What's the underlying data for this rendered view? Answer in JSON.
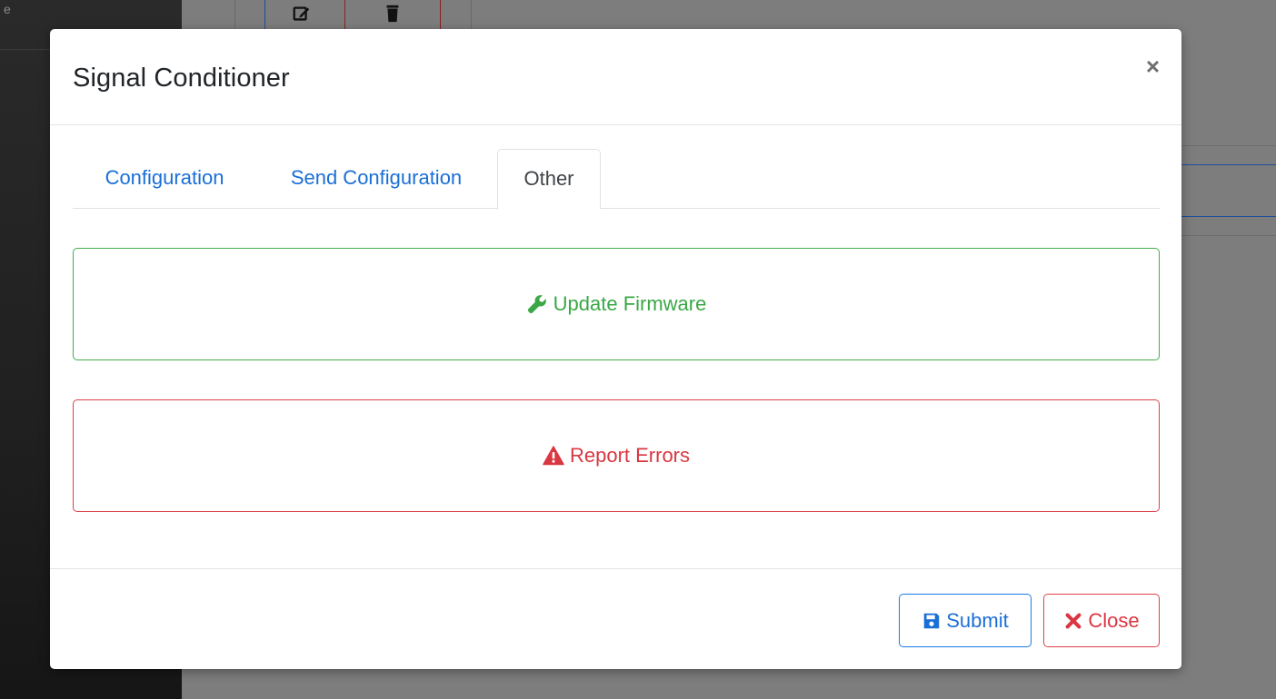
{
  "background": {
    "edge_char": "e"
  },
  "modal": {
    "title": "Signal Conditioner",
    "close_symbol": "×",
    "tabs": [
      {
        "label": "Configuration",
        "active": false
      },
      {
        "label": "Send Configuration",
        "active": false
      },
      {
        "label": "Other",
        "active": true
      }
    ],
    "actions": {
      "update_firmware": {
        "label": "Update Firmware",
        "icon": "wrench-icon",
        "color": "#3aa846"
      },
      "report_errors": {
        "label": "Report Errors",
        "icon": "warning-triangle-icon",
        "color": "#d93741"
      }
    },
    "footer": {
      "submit_label": "Submit",
      "submit_icon": "save-icon",
      "close_label": "Close",
      "close_icon": "x-icon"
    }
  },
  "colors": {
    "primary": "#1a6fd6",
    "success": "#3aa846",
    "danger": "#d93741"
  }
}
